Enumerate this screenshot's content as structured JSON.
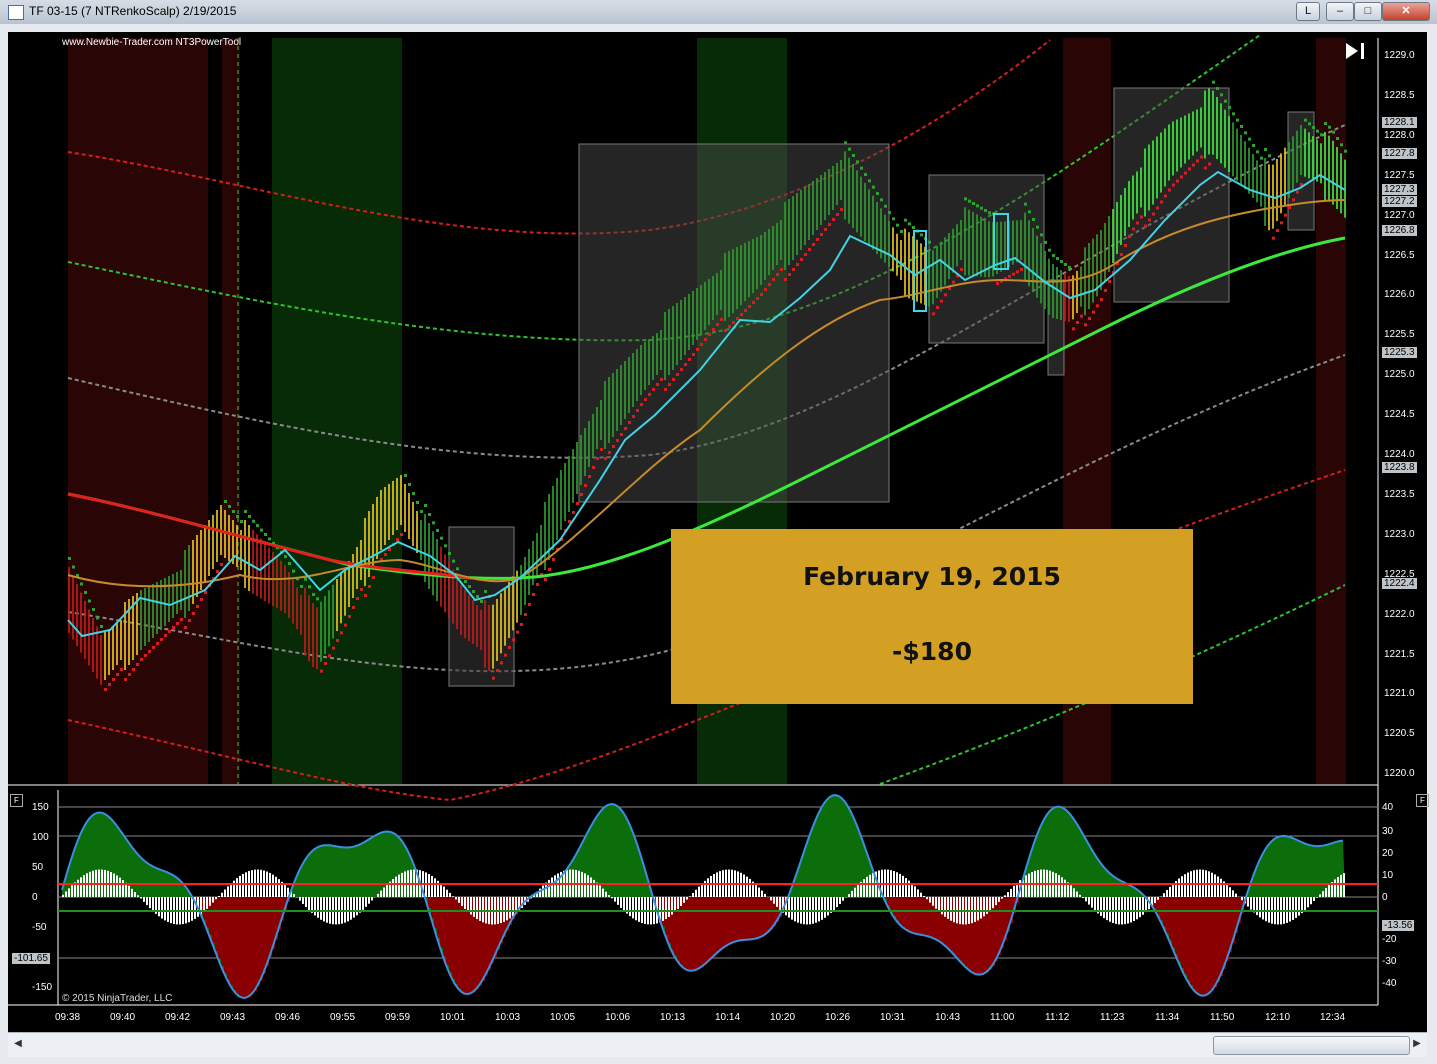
{
  "window": {
    "title": "TF 03-15 (7 NTRenkoScalp)  2/19/2015",
    "btn_l": "L",
    "btn_min": "–",
    "btn_max": "□",
    "btn_close": "✕"
  },
  "chart": {
    "source_label": "www.Newbie-Trader.com NT3PowerTool",
    "copyright": "© 2015 NinjaTrader, LLC",
    "f_badge": "F",
    "price_axis": [
      "1229.0",
      "1228.5",
      "1228.0",
      "1227.5",
      "1227.0",
      "1226.5",
      "1226.0",
      "1225.5",
      "1225.0",
      "1224.5",
      "1224.0",
      "1223.5",
      "1223.0",
      "1222.5",
      "1222.0",
      "1221.5",
      "1221.0",
      "1220.5",
      "1220.0"
    ],
    "price_tags": [
      "1228.1",
      "1227.8",
      "1227.3",
      "1227.2",
      "1226.8",
      "1225.3",
      "1223.8",
      "1222.4"
    ],
    "osc_axis_left": [
      "150",
      "100",
      "50",
      "0",
      "-50",
      "-101.65",
      "-150"
    ],
    "osc_axis_right": [
      "40",
      "30",
      "20",
      "10",
      "0",
      "-13.56",
      "-20",
      "-30",
      "-40"
    ],
    "time_axis": [
      "09:38",
      "09:40",
      "09:42",
      "09:43",
      "09:46",
      "09:55",
      "09:59",
      "10:01",
      "10:03",
      "10:05",
      "10:06",
      "10:13",
      "10:14",
      "10:20",
      "10:26",
      "10:31",
      "10:43",
      "11:00",
      "11:12",
      "11:23",
      "11:34",
      "11:50",
      "12:10",
      "12:34"
    ]
  },
  "info": {
    "date": "February 19, 2015",
    "amount": "-$180"
  },
  "colors": {
    "bull": "#2fa12f",
    "bear": "#d21f1f",
    "neutral": "#e6c21f",
    "cyan": "#3fd4e6",
    "info_bg": "#d4a024"
  }
}
